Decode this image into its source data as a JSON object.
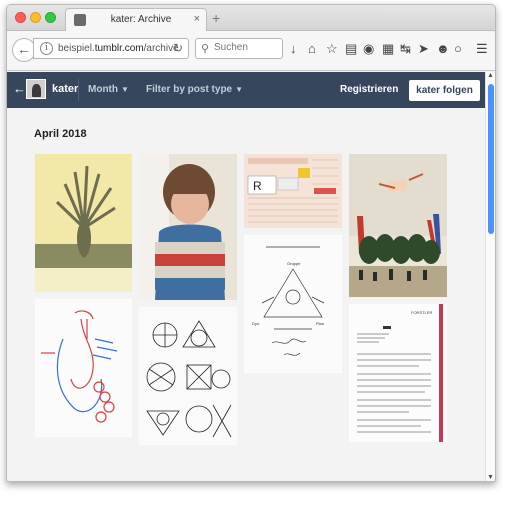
{
  "browser": {
    "tab_title": "kater: Archive",
    "tab_close": "×",
    "new_tab": "+",
    "url_host": "beispiel.",
    "url_domain": "tumblr.com",
    "url_path": "/archive",
    "search_placeholder": "Suchen"
  },
  "header": {
    "blog_name": "kater",
    "filter_month": "Month",
    "filter_type": "Filter by post type",
    "register": "Registrieren",
    "follow": "kater folgen"
  },
  "archive": {
    "section_title": "April 2018"
  },
  "posts": [
    {
      "name": "plant-print"
    },
    {
      "name": "child-photo"
    },
    {
      "name": "postal-form"
    },
    {
      "name": "balloon-painting"
    },
    {
      "name": "heart-sketch"
    },
    {
      "name": "geometric-drawings"
    },
    {
      "name": "triangle-diagram"
    },
    {
      "name": "letter-document"
    }
  ],
  "colors": {
    "header_bg": "#36465d",
    "scroll_thumb": "#4d90fe"
  }
}
